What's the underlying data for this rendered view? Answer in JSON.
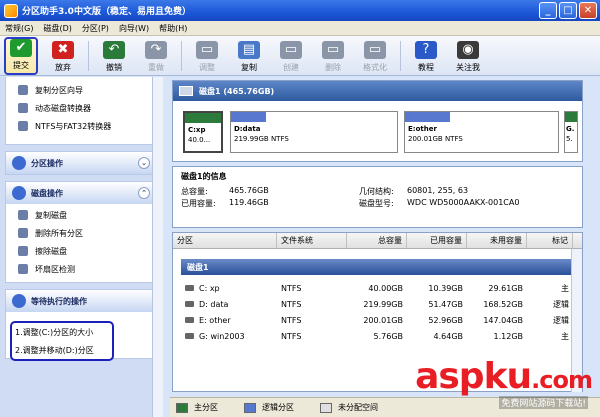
{
  "window": {
    "title": "分区助手3.0中文版（稳定、易用且免费）"
  },
  "menu": [
    "常规(G)",
    "磁盘(D)",
    "分区(P)",
    "向导(W)",
    "帮助(H)"
  ],
  "toolbar": [
    {
      "label": "提交",
      "icon": "checkmark-icon",
      "color": "#1f9a2e",
      "enabled": true
    },
    {
      "label": "放弃",
      "icon": "cross-icon",
      "color": "#d02020",
      "enabled": true
    },
    {
      "label": "撤销",
      "icon": "undo-icon",
      "color": "#2a7a3a",
      "enabled": true
    },
    {
      "label": "重做",
      "icon": "redo-icon",
      "color": "#8a96a8",
      "enabled": false
    },
    {
      "label": "调整",
      "icon": "resize-icon",
      "color": "#8a96a8",
      "enabled": false
    },
    {
      "label": "复制",
      "icon": "copy-icon",
      "color": "#4a78c8",
      "enabled": true
    },
    {
      "label": "创建",
      "icon": "create-icon",
      "color": "#8a96a8",
      "enabled": false
    },
    {
      "label": "删除",
      "icon": "delete-icon",
      "color": "#8a96a8",
      "enabled": false
    },
    {
      "label": "格式化",
      "icon": "format-icon",
      "color": "#8a96a8",
      "enabled": false
    },
    {
      "label": "教程",
      "icon": "help-icon",
      "color": "#2a5ac8",
      "enabled": true
    },
    {
      "label": "关注我",
      "icon": "follow-icon",
      "color": "#3a3a3a",
      "enabled": true
    }
  ],
  "left": {
    "wizard_items": [
      "复制分区向导",
      "动态磁盘转换器",
      "NTFS与FAT32转换器"
    ],
    "partition_ops_title": "分区操作",
    "disk_ops_title": "磁盘操作",
    "disk_ops_items": [
      "复制磁盘",
      "删除所有分区",
      "擦除磁盘",
      "坏扇区检测"
    ],
    "pending_title": "等待执行的操作",
    "pending_items": [
      "1.调整(C:)分区的大小",
      "2.调整并移动(D:)分区"
    ]
  },
  "diskmap": {
    "title": "磁盘1 (465.76GB)",
    "partitions": [
      {
        "name": "C:xp",
        "size": "40.0...",
        "color": "#2c7a3c"
      },
      {
        "name": "D:data",
        "size": "219.99GB NTFS",
        "color": "#5878d0"
      },
      {
        "name": "E:other",
        "size": "200.01GB NTFS",
        "color": "#5878d0"
      },
      {
        "name": "G.",
        "size": "5.",
        "color": "#2c7a3c"
      }
    ]
  },
  "info": {
    "title": "磁盘1的信息",
    "total_label": "总容量:",
    "total": "465.76GB",
    "used_label": "已用容量:",
    "used": "119.46GB",
    "geometry_label": "几何结构:",
    "geometry": "60801, 255, 63",
    "model_label": "磁盘型号:",
    "model": "WDC WD5000AAKX-001CA0"
  },
  "table": {
    "headers": [
      "分区",
      "文件系统",
      "总容量",
      "已用容量",
      "未用容量",
      "标记"
    ],
    "disk_label": "磁盘1",
    "rows": [
      {
        "part": "C:  xp",
        "fs": "NTFS",
        "total": "40.00GB",
        "used": "10.39GB",
        "free": "29.61GB",
        "flag": "主"
      },
      {
        "part": "D:  data",
        "fs": "NTFS",
        "total": "219.99GB",
        "used": "51.47GB",
        "free": "168.52GB",
        "flag": "逻辑"
      },
      {
        "part": "E:  other",
        "fs": "NTFS",
        "total": "200.01GB",
        "used": "52.96GB",
        "free": "147.04GB",
        "flag": "逻辑"
      },
      {
        "part": "G:  win2003",
        "fs": "NTFS",
        "total": "5.76GB",
        "used": "4.64GB",
        "free": "1.12GB",
        "flag": "主"
      }
    ]
  },
  "legend": [
    {
      "label": "主分区",
      "color": "#2c7a3c"
    },
    {
      "label": "逻辑分区",
      "color": "#5878d0"
    },
    {
      "label": "未分配空间",
      "color": "#e0e0e0"
    }
  ],
  "watermark": {
    "brand_a": "asp",
    "brand_b": "ku",
    "brand_c": ".com",
    "sub": "免费网站源码下载站!"
  }
}
